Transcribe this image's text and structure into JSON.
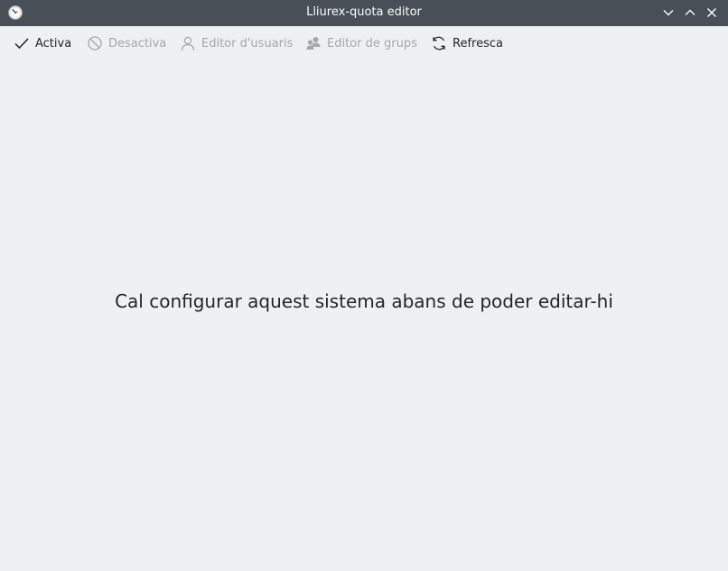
{
  "window": {
    "title": "Lliurex-quota editor",
    "titlebar_color": "#475057",
    "background_color": "#eff0f1"
  },
  "toolbar": {
    "items": [
      {
        "label": "Activa",
        "icon": "checkmark-icon",
        "enabled": true
      },
      {
        "label": "Desactiva",
        "icon": "disable-icon",
        "enabled": false
      },
      {
        "label": "Editor d'usuaris",
        "icon": "user-icon",
        "enabled": false
      },
      {
        "label": "Editor de grups",
        "icon": "group-icon",
        "enabled": false
      },
      {
        "label": "Refresca",
        "icon": "refresh-icon",
        "enabled": true
      }
    ]
  },
  "main": {
    "message": "Cal configurar aquest sistema abans de poder editar-hi"
  }
}
